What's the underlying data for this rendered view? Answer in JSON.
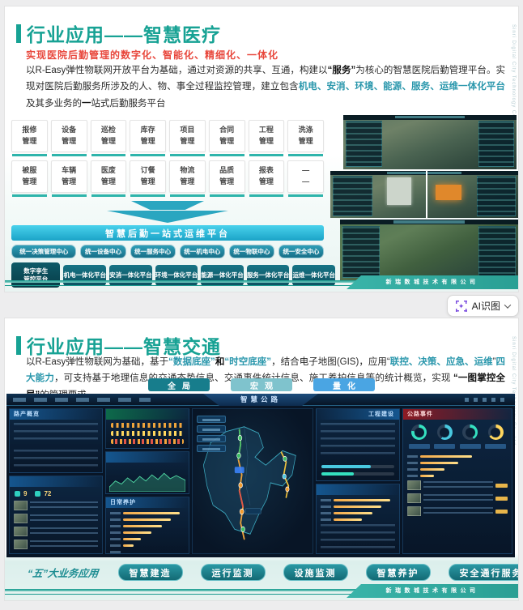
{
  "ui": {
    "ai_button": {
      "label": "AI识图"
    }
  },
  "slide1": {
    "title": "行业应用——智慧医疗",
    "subtitle": "实现医院后勤管理的数字化、智能化、精细化、一体化",
    "body": [
      {
        "t": "以R-Easy弹性物联网开放平台为基础，通过对资源的共享、互通，构建以",
        "s": "n"
      },
      {
        "t": "“服务”",
        "s": "b"
      },
      {
        "t": "为核心的智慧医院后勤管理平台。实现对医院后勤服务所涉及的人、物、事全过程监控管理，建立包含",
        "s": "n"
      },
      {
        "t": "机电、安消、环境、能源、服务、运维一体化平台",
        "s": "t"
      },
      {
        "t": "及其多业务的",
        "s": "n"
      },
      {
        "t": "一",
        "s": "b"
      },
      {
        "t": "站式后勤服务平台",
        "s": "n"
      }
    ],
    "modules_row1": [
      "报修\n管理",
      "设备\n管理",
      "巡检\n管理",
      "库存\n管理",
      "项目\n管理",
      "合同\n管理",
      "工程\n管理",
      "洗涤\n管理"
    ],
    "modules_row2": [
      "被服\n管理",
      "车辆\n管理",
      "医废\n管理",
      "订餐\n管理",
      "物流\n管理",
      "品质\n管理",
      "报表\n管理",
      "—\n—"
    ],
    "banner": "智慧后勤一站式运维平台",
    "centers": [
      "统一决策管理中心",
      "统一设备中心",
      "统一服务中心",
      "统一机电中心",
      "统一物联中心",
      "统一安全中心"
    ],
    "platforms": [
      "数字孪生\n管控平台",
      "机电一体化平台",
      "安消一体化平台",
      "环境一体化平台",
      "能源一体化平台",
      "服务一体化平台",
      "运维一体化平台"
    ],
    "footer_company": "新瑞数城技术有限公司",
    "side_text": "Sinri Digital City Technology Co., Ltd"
  },
  "slide2": {
    "title": "行业应用——智慧交通",
    "body": [
      {
        "t": "以R-Easy弹性物联网为基础，基于",
        "s": "n"
      },
      {
        "t": "“数据底座”",
        "s": "t"
      },
      {
        "t": "和",
        "s": "b"
      },
      {
        "t": "“时空底座”",
        "s": "t"
      },
      {
        "t": "，结合电子地图(GIS)，应用“",
        "s": "n"
      },
      {
        "t": "联控、决策、应急、运维",
        "s": "t"
      },
      {
        "t": "”",
        "s": "n"
      },
      {
        "t": "四大能力",
        "s": "t"
      },
      {
        "t": "，可支持基于地理信息的交通态势信息、交通事件统计信息、施工养护信息等的统计概览，实现 ",
        "s": "n"
      },
      {
        "t": "“一图掌控全局”",
        "s": "b"
      },
      {
        "t": "的管理要求。",
        "s": "n"
      }
    ],
    "view_tabs": [
      "全局",
      "宏观",
      "量化"
    ],
    "dashboard": {
      "title": "智慧公路",
      "panel_overview": "路产概览",
      "panel_maintain": "日常养护",
      "panel_construction": "工程建设",
      "panel_events": "公路事件",
      "stat1": "9",
      "stat2": "72"
    },
    "biz_label": "“五”大业务应用",
    "biz_buttons": [
      "智慧建造",
      "运行监测",
      "设施监测",
      "智慧养护",
      "安全通行服务"
    ],
    "footer_company": "新瑞数城技术有限公司",
    "side_text": "Sinri Digital City Technology Co., Ltd"
  }
}
